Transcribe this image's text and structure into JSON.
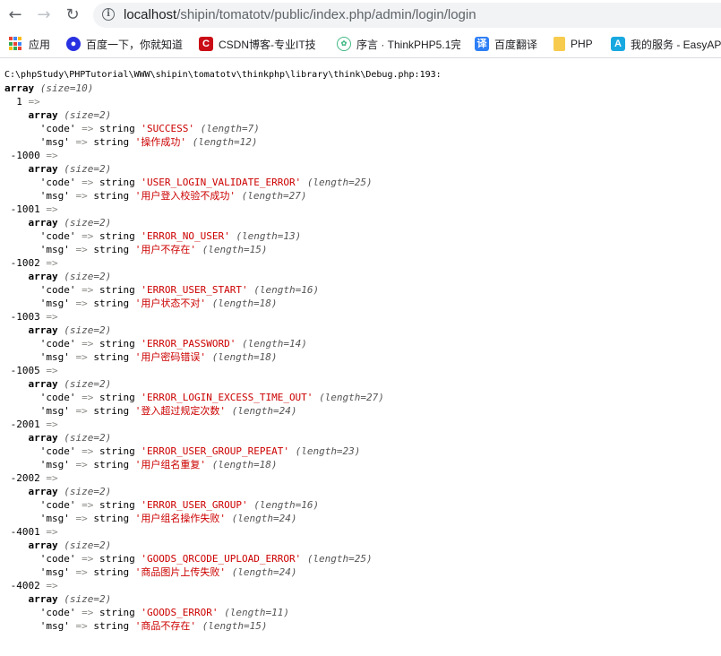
{
  "browser": {
    "url_host": "localhost",
    "url_path": "/shipin/tomatotv/public/index.php/admin/login/login"
  },
  "bookmarks": [
    {
      "label": "应用",
      "icon": "apps-grid-icon"
    },
    {
      "label": "百度一下，你就知道",
      "icon": "paw-icon",
      "color": "#2932e1"
    },
    {
      "label": "CSDN博客-专业IT技",
      "icon": "csdn-icon",
      "color": "#ca0c16"
    },
    {
      "label": "序言 · ThinkPHP5.1完",
      "icon": "leaf-icon",
      "color": "#42b983"
    },
    {
      "label": "百度翻译",
      "icon": "translate-icon",
      "color": "#2e7ff6"
    },
    {
      "label": "PHP",
      "icon": "folder-icon",
      "color": "#f7cb4d"
    },
    {
      "label": "我的服务 - EasyAP",
      "icon": "appstore-icon",
      "color": "#19a9e1"
    }
  ],
  "debug": {
    "file": "C:\\phpStudy\\PHPTutorial\\WWW\\shipin\\tomatotv\\thinkphp\\library\\think\\Debug.php:193:",
    "array_size": "(size=10)",
    "entries": [
      {
        "key": "1",
        "code": "'SUCCESS'",
        "code_len": "(length=7)",
        "msg": "'操作成功'",
        "msg_len": "(length=12)"
      },
      {
        "key": "-1000",
        "code": "'USER_LOGIN_VALIDATE_ERROR'",
        "code_len": "(length=25)",
        "msg": "'用户登入校验不成功'",
        "msg_len": "(length=27)"
      },
      {
        "key": "-1001",
        "code": "'ERROR_NO_USER'",
        "code_len": "(length=13)",
        "msg": "'用户不存在'",
        "msg_len": "(length=15)"
      },
      {
        "key": "-1002",
        "code": "'ERROR_USER_START'",
        "code_len": "(length=16)",
        "msg": "'用户状态不对'",
        "msg_len": "(length=18)"
      },
      {
        "key": "-1003",
        "code": "'ERROR_PASSWORD'",
        "code_len": "(length=14)",
        "msg": "'用户密码错误'",
        "msg_len": "(length=18)"
      },
      {
        "key": "-1005",
        "code": "'ERROR_LOGIN_EXCESS_TIME_OUT'",
        "code_len": "(length=27)",
        "msg": "'登入超过规定次数'",
        "msg_len": "(length=24)"
      },
      {
        "key": "-2001",
        "code": "'ERROR_USER_GROUP_REPEAT'",
        "code_len": "(length=23)",
        "msg": "'用户组名重复'",
        "msg_len": "(length=18)"
      },
      {
        "key": "-2002",
        "code": "'ERROR_USER_GROUP'",
        "code_len": "(length=16)",
        "msg": "'用户组名操作失败'",
        "msg_len": "(length=24)"
      },
      {
        "key": "-4001",
        "code": "'GOODS_QRCODE_UPLOAD_ERROR'",
        "code_len": "(length=25)",
        "msg": "'商品图片上传失败'",
        "msg_len": "(length=24)"
      },
      {
        "key": "-4002",
        "code": "'GOODS_ERROR'",
        "code_len": "(length=11)",
        "msg": "'商品不存在'",
        "msg_len": "(length=15)"
      }
    ]
  },
  "labels": {
    "array": "array",
    "size2": "(size=2)",
    "arrow": "=>",
    "code_key": "'code'",
    "msg_key": "'msg'",
    "string": "string"
  }
}
